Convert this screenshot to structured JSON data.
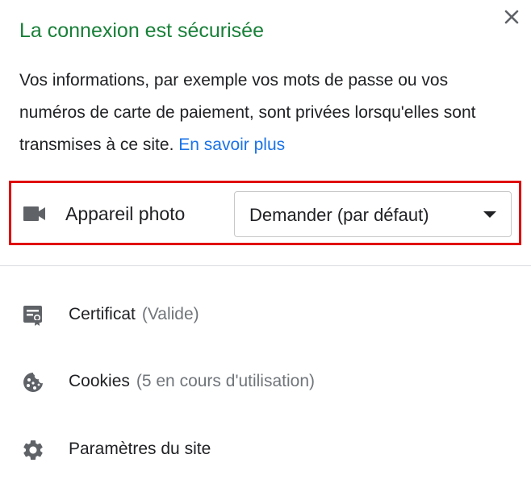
{
  "header": {
    "title": "La connexion est sécurisée",
    "close_icon": "close-icon"
  },
  "description": {
    "text": "Vos informations, par exemple vos mots de passe ou vos numéros de carte de paiement, sont privées lorsqu'elles sont transmises à ce site.",
    "link_label": "En savoir plus"
  },
  "permission": {
    "icon": "camera-icon",
    "label": "Appareil photo",
    "selected_value": "Demander (par défaut)",
    "highlight_color": "#e00000"
  },
  "items": [
    {
      "icon": "certificate-icon",
      "label": "Certificat",
      "detail": "(Valide)"
    },
    {
      "icon": "cookie-icon",
      "label": "Cookies",
      "detail": "(5 en cours d'utilisation)"
    },
    {
      "icon": "gear-icon",
      "label": "Paramètres du site",
      "detail": ""
    }
  ],
  "colors": {
    "title": "#188038",
    "link": "#1a73e8",
    "text": "#202124",
    "secondary_text": "#70757a",
    "icon": "#5f6368"
  }
}
